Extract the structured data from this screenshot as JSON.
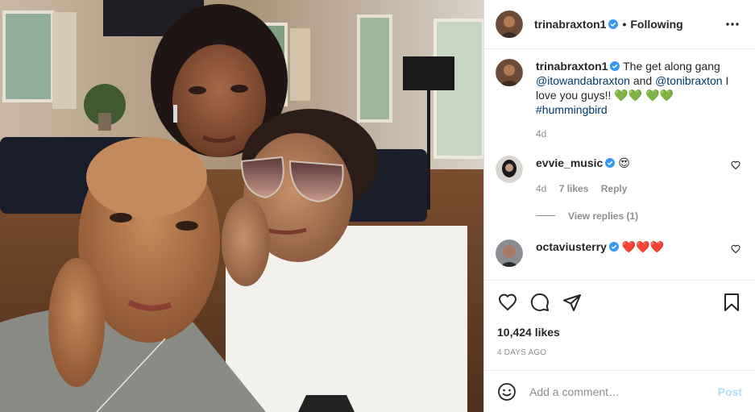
{
  "header": {
    "username": "trinabraxton1",
    "separator": "•",
    "follow_state": "Following",
    "more_icon": "more-horizontal-icon"
  },
  "caption": {
    "username": "trinabraxton1",
    "text_1": "The get along gang",
    "mention_1": "@itowandabraxton",
    "text_2": "and",
    "mention_2": "@tonibraxton",
    "text_3": "I love you guys!!",
    "emoji_1": "💚💚",
    "emoji_2": "💚💚",
    "hashtag": "#hummingbird",
    "age": "4d"
  },
  "comments": [
    {
      "username": "evvie_music",
      "emoji": "😍",
      "age": "4d",
      "likes": "7 likes",
      "reply": "Reply"
    },
    {
      "username": "octaviusterry",
      "emoji": "❤️❤️❤️"
    }
  ],
  "view_replies": "View replies (1)",
  "actions": {
    "icons": [
      "heart-icon",
      "comment-icon",
      "share-icon",
      "bookmark-icon"
    ]
  },
  "likes": "10,424 likes",
  "posted": "4 DAYS AGO",
  "add_comment": {
    "placeholder": "Add a comment…",
    "post_label": "Post"
  },
  "colors": {
    "verified": "#3897f0",
    "link": "#00376b",
    "post_disabled": "#b2dffc",
    "secondary_text": "#8e8e8e"
  }
}
